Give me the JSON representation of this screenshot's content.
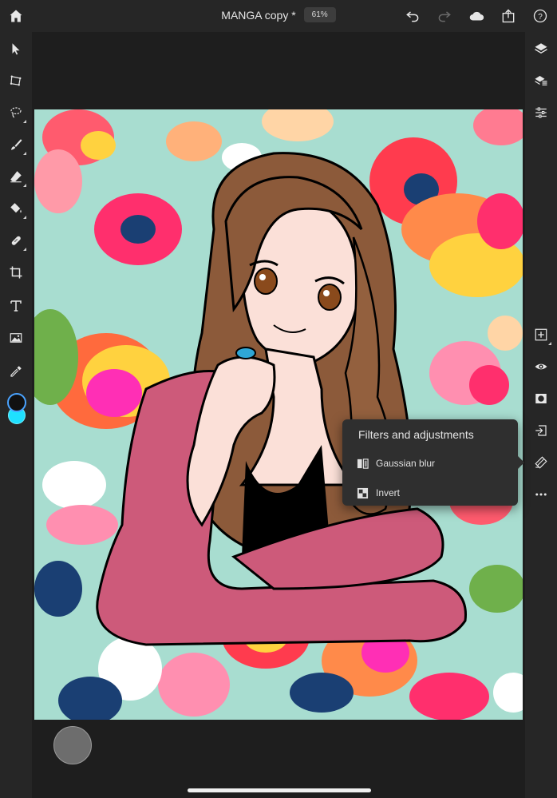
{
  "app": {
    "document_title": "MANGA copy *",
    "zoom_level": "61%"
  },
  "colors": {
    "chrome": "#262626",
    "canvas_bg": "#1e1e1e",
    "artboard_bg": "#a8ddd0",
    "foreground_swatch": "#111111",
    "background_swatch": "#1fe0ff",
    "popover_bg": "#2f2f2f"
  },
  "top_bar": {
    "left_icons": [
      "home-icon"
    ],
    "right_icons": [
      "undo-icon",
      "redo-icon",
      "cloud-icon",
      "share-icon",
      "help-icon"
    ]
  },
  "left_toolbar": {
    "tools": [
      "select-icon",
      "transform-icon",
      "lasso-icon",
      "brush-icon",
      "eraser-icon",
      "fill-icon",
      "healing-icon",
      "crop-icon",
      "type-icon",
      "place-image-icon",
      "eyedropper-icon"
    ]
  },
  "right_toolbar": {
    "tools": [
      "layers-icon",
      "layer-details-icon",
      "adjustments-icon",
      "add-layer-icon",
      "visibility-icon",
      "mask-icon",
      "import-icon",
      "filters-icon",
      "more-icon"
    ]
  },
  "filters_popover": {
    "title": "Filters and adjustments",
    "items": [
      {
        "label": "Gaussian blur",
        "icon": "gaussian-blur-icon"
      },
      {
        "label": "Invert",
        "icon": "invert-icon"
      }
    ]
  }
}
